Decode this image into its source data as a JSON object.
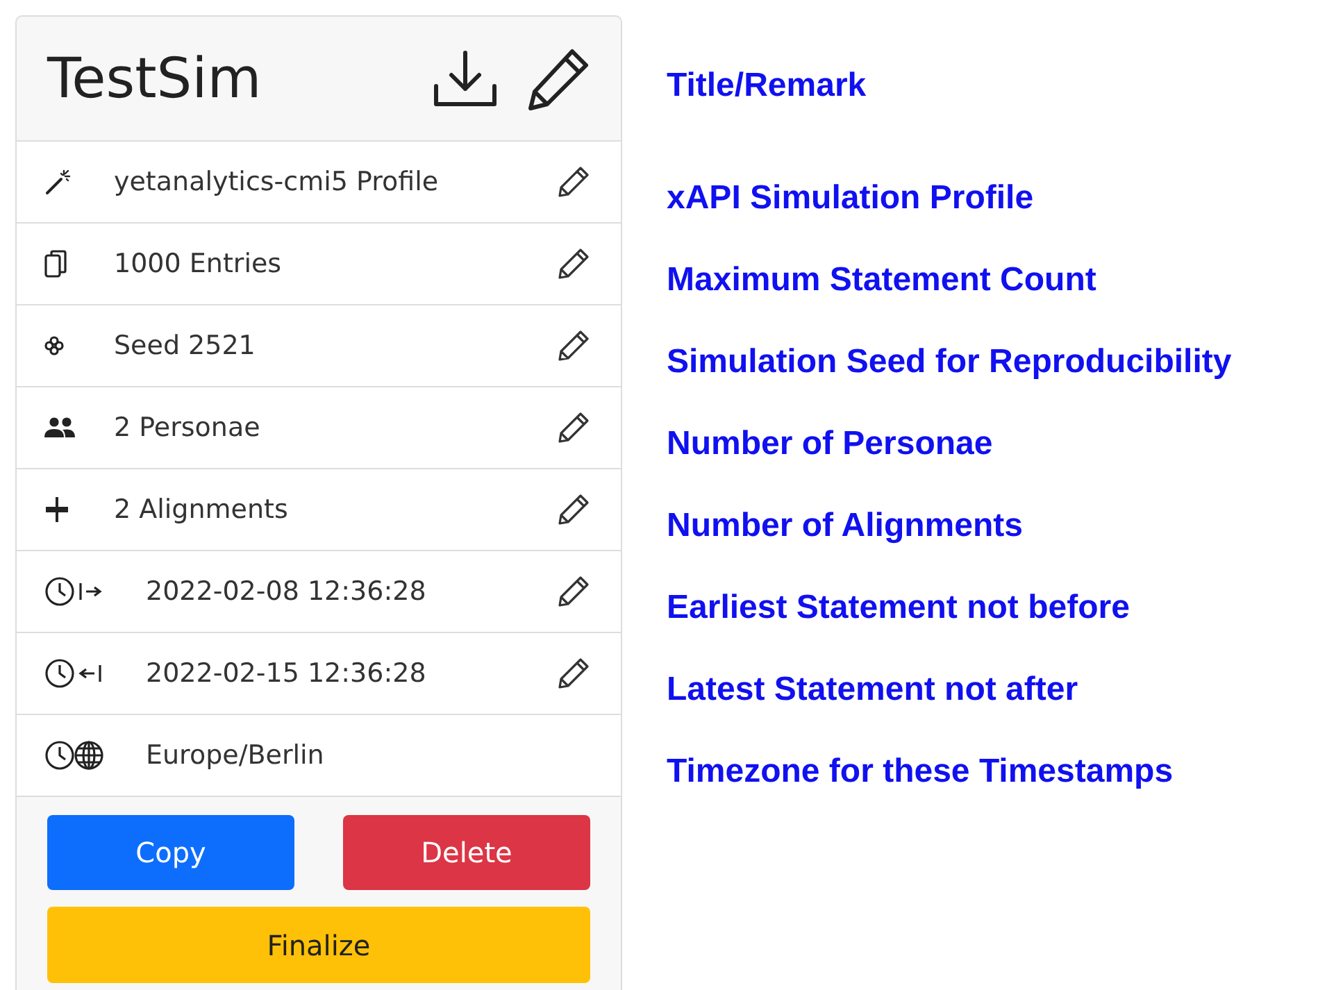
{
  "header": {
    "title": "TestSim",
    "annotation": "Title/Remark"
  },
  "rows": [
    {
      "kind": "profile",
      "text": "yetanalytics-cmi5 Profile",
      "editable": true,
      "annotation": "xAPI Simulation Profile"
    },
    {
      "kind": "count",
      "text": "1000 Entries",
      "editable": true,
      "annotation": "Maximum Statement Count"
    },
    {
      "kind": "seed",
      "text": "Seed 2521",
      "editable": true,
      "annotation": "Simulation Seed for Reproducibility"
    },
    {
      "kind": "personae",
      "text": "2 Personae",
      "editable": true,
      "annotation": "Number of Personae"
    },
    {
      "kind": "alignments",
      "text": "2 Alignments",
      "editable": true,
      "annotation": "Number of Alignments"
    },
    {
      "kind": "start",
      "text": "2022-02-08 12:36:28",
      "editable": true,
      "annotation": "Earliest Statement not before"
    },
    {
      "kind": "end",
      "text": "2022-02-15 12:36:28",
      "editable": true,
      "annotation": "Latest Statement not after"
    },
    {
      "kind": "timezone",
      "text": "Europe/Berlin",
      "editable": false,
      "annotation": "Timezone for these Timestamps"
    }
  ],
  "buttons": [
    {
      "kind": "primary",
      "label": "Copy"
    },
    {
      "kind": "danger",
      "label": "Delete"
    },
    {
      "kind": "warning",
      "label": "Finalize"
    }
  ]
}
